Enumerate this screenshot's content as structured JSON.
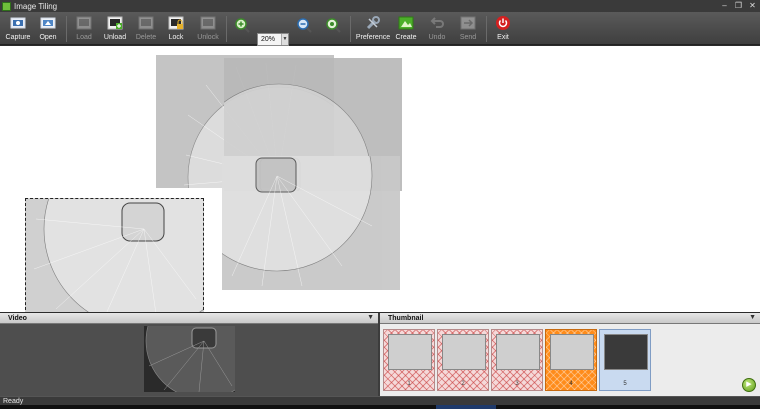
{
  "window": {
    "title": "Image Tiling"
  },
  "toolbar": {
    "capture": "Capture",
    "open": "Open",
    "load": "Load",
    "unload": "Unload",
    "delete": "Delete",
    "lock": "Lock",
    "unlock": "Unlock",
    "zoom_value": "20%",
    "preference": "Preference",
    "create": "Create",
    "undo": "Undo",
    "send": "Send",
    "exit": "Exit"
  },
  "panels": {
    "video_title": "Video",
    "thumbnail_title": "Thumbnail",
    "thumbnails": [
      {
        "num": "1"
      },
      {
        "num": "2"
      },
      {
        "num": "3"
      },
      {
        "num": "4"
      },
      {
        "num": "5"
      }
    ]
  },
  "status": {
    "text": "Ready"
  },
  "colors": {
    "accent_orange": "#ff8c1a",
    "exit_red": "#d42020",
    "create_green": "#4caf2a"
  }
}
